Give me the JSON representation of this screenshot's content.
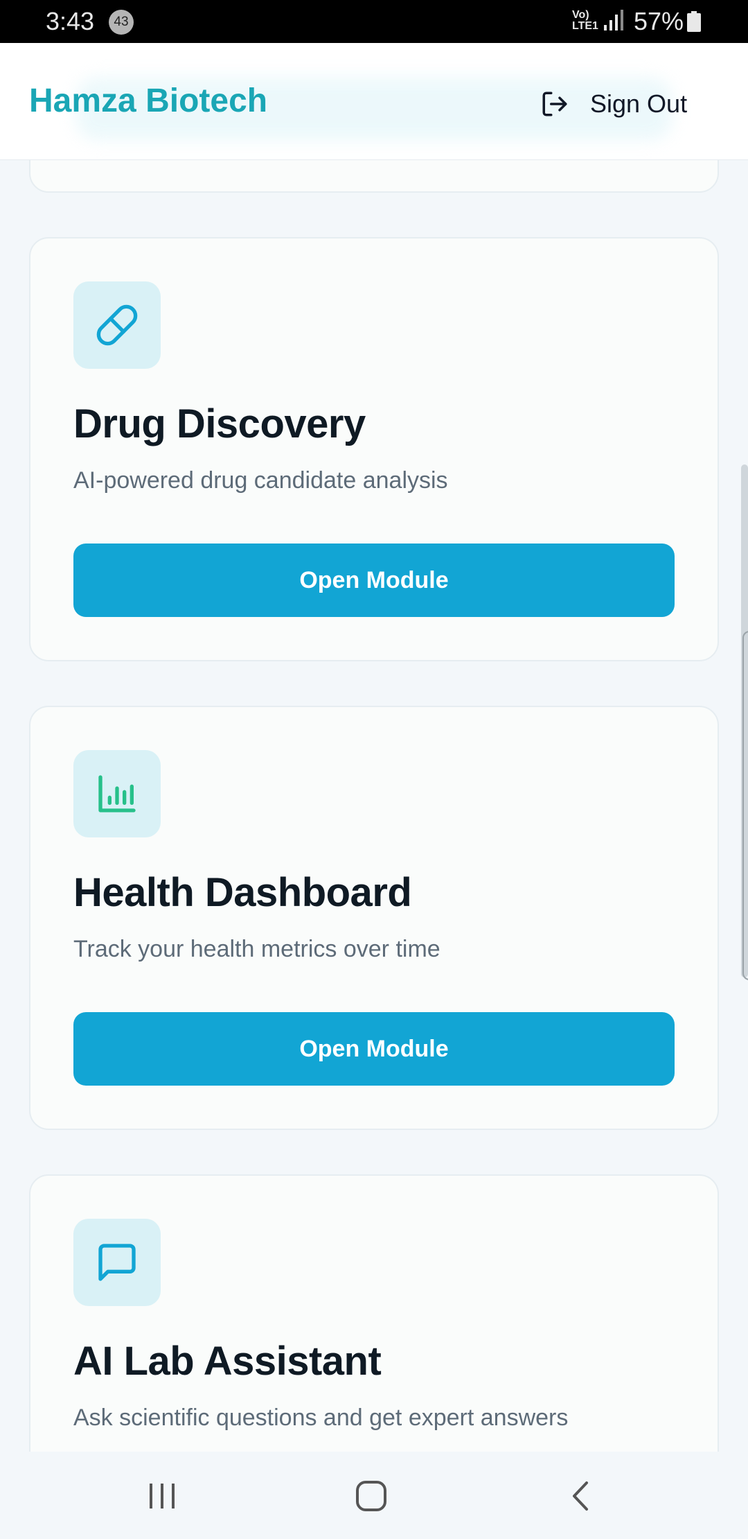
{
  "status_bar": {
    "time": "3:43",
    "notification_count": "43",
    "network_label": "Vo) LTE1",
    "battery": "57%"
  },
  "header": {
    "brand": "Hamza Biotech",
    "sign_out_label": "Sign Out",
    "sign_out_icon": "log-out-icon"
  },
  "modules": [
    {
      "icon": "pill-icon",
      "title": "Drug Discovery",
      "description": "AI-powered drug candidate analysis",
      "button": "Open Module"
    },
    {
      "icon": "bar-chart-icon",
      "title": "Health Dashboard",
      "description": "Track your health metrics over time",
      "button": "Open Module"
    },
    {
      "icon": "message-square-icon",
      "title": "AI Lab Assistant",
      "description": "Ask scientific questions and get expert answers"
    }
  ],
  "nav": {
    "recents_icon": "recents-icon",
    "home_icon": "home-icon",
    "back_icon": "back-icon"
  },
  "colors": {
    "accent": "#12a5d4",
    "brand": "#1aa6b5",
    "icon_tile": "#d9f1f6",
    "chart_icon": "#27c08a"
  }
}
